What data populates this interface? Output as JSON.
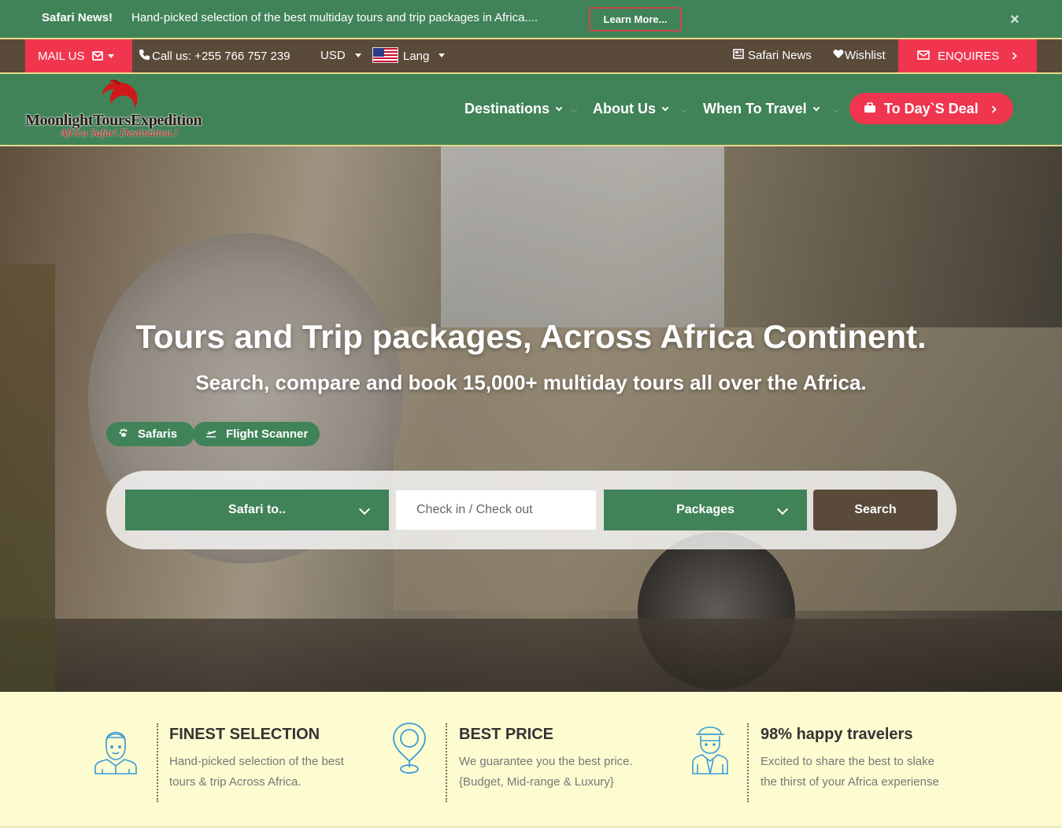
{
  "newsbar": {
    "label": "Safari News!",
    "text": "Hand-picked selection of the best multiday tours and trip packages in Africa....",
    "learn_more": "Learn More...",
    "close": "×"
  },
  "utilbar": {
    "mail_us": "MAIL US",
    "call_us": "Call us: +255 766 757 239",
    "currency": "USD",
    "lang": "Lang",
    "safari_news": "Safari News",
    "wishlist": "Wishlist",
    "enquires": "ENQUIRES"
  },
  "logo": {
    "name": "MoonlightToursExpedition",
    "tagline": "Africa Safari Destination.!"
  },
  "nav": {
    "destinations": "Destinations",
    "about_us": "About Us",
    "when_to_travel": "When To Travel",
    "deal": "To Day`S Deal"
  },
  "hero": {
    "title": "Tours and Trip packages, Across Africa Continent.",
    "subtitle": "Search, compare and book 15,000+ multiday tours all over the Africa.",
    "tabs": [
      {
        "label": "Safaris",
        "icon": "paw-icon"
      },
      {
        "label": "Flight Scanner",
        "icon": "plane-icon"
      }
    ],
    "search": {
      "safari_to": "Safari to..",
      "dates": "Check in / Check out",
      "packages": "Packages",
      "button": "Search"
    }
  },
  "features": [
    {
      "title": "FINEST SELECTION",
      "line1": "Hand-picked selection of the best",
      "line2": "tours & trip Across Africa."
    },
    {
      "title": "BEST PRICE",
      "line1": "We guarantee you the best price.",
      "line2": "{Budget, Mid-range & Luxury}"
    },
    {
      "title": "98% happy travelers",
      "line1": "Excited to share the best to slake",
      "line2": "the thirst of your Africa experiense"
    }
  ],
  "colors": {
    "green": "#418359",
    "red": "#f0364f",
    "brown": "#5a4a3a",
    "cream": "#fdfcd0",
    "icon_blue": "#3a9ad9"
  }
}
